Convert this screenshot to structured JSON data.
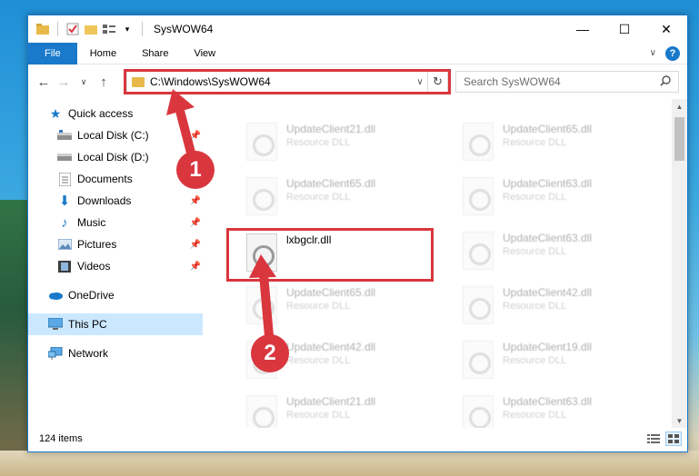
{
  "window": {
    "title": "SysWOW64"
  },
  "ribbon": {
    "tabs": [
      "File",
      "Home",
      "Share",
      "View"
    ]
  },
  "address": {
    "path": "C:\\Windows\\SysWOW64"
  },
  "search": {
    "placeholder": "Search SysWOW64"
  },
  "nav": {
    "items": [
      {
        "label": "Quick access",
        "icon": "star-icon"
      },
      {
        "label": "Local Disk (C:)",
        "icon": "drive-icon"
      },
      {
        "label": "Local Disk (D:)",
        "icon": "drive-icon"
      },
      {
        "label": "Documents",
        "icon": "documents-icon"
      },
      {
        "label": "Downloads",
        "icon": "download-icon"
      },
      {
        "label": "Music",
        "icon": "music-icon"
      },
      {
        "label": "Pictures",
        "icon": "pictures-icon"
      },
      {
        "label": "Videos",
        "icon": "videos-icon"
      },
      {
        "label": "OneDrive",
        "icon": "cloud-icon"
      },
      {
        "label": "This PC",
        "icon": "computer-icon"
      },
      {
        "label": "Network",
        "icon": "network-icon"
      }
    ]
  },
  "files": {
    "highlighted": {
      "name": "lxbgclr.dll"
    },
    "left_column": [
      {
        "name": "UpdateClient21.dll",
        "type": "Resource DLL"
      },
      {
        "name": "UpdateClient65.dll",
        "type": "Resource DLL"
      },
      {
        "name": "UpdateClient65.dll",
        "type": "Resource DLL"
      },
      {
        "name": "UpdateClient42.dll",
        "type": "Resource DLL"
      },
      {
        "name": "UpdateClient21.dll",
        "type": "Resource DLL"
      }
    ],
    "right_column": [
      {
        "name": "UpdateClient65.dll",
        "type": "Resource DLL"
      },
      {
        "name": "UpdateClient63.dll",
        "type": "Resource DLL"
      },
      {
        "name": "UpdateClient63.dll",
        "type": "Resource DLL"
      },
      {
        "name": "UpdateClient42.dll",
        "type": "Resource DLL"
      },
      {
        "name": "UpdateClient19.dll",
        "type": "Resource DLL"
      },
      {
        "name": "UpdateClient63.dll",
        "type": "Resource DLL"
      }
    ]
  },
  "status": {
    "item_count": "124 items"
  },
  "annotations": {
    "step1": "1",
    "step2": "2",
    "color": "#d9363e"
  }
}
